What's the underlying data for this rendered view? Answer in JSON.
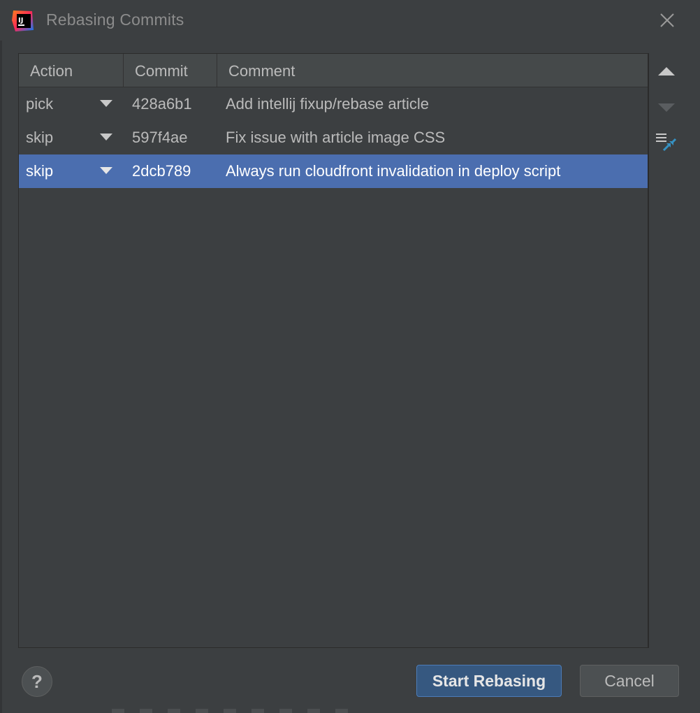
{
  "window": {
    "title": "Rebasing Commits"
  },
  "icons": {
    "app_logo": "intellij-logo-icon",
    "close": "close-icon",
    "move_up": "triangle-up-icon",
    "move_down": "triangle-down-icon",
    "squash": "squash-commits-icon",
    "help": "help-icon"
  },
  "table": {
    "columns": [
      "Action",
      "Commit",
      "Comment"
    ],
    "rows": [
      {
        "action": "pick",
        "commit": "428a6b1",
        "comment": "Add intellij fixup/rebase article",
        "selected": false
      },
      {
        "action": "skip",
        "commit": "597f4ae",
        "comment": "Fix issue with article image CSS",
        "selected": false
      },
      {
        "action": "skip",
        "commit": "2dcb789",
        "comment": "Always run cloudfront invalidation in deploy script",
        "selected": true
      }
    ]
  },
  "buttons": {
    "help_label": "?",
    "start_label": "Start Rebasing",
    "cancel_label": "Cancel"
  },
  "colors": {
    "background": "#3c3f41",
    "selection": "#4b6eaf",
    "primary_button": "#365880",
    "squash_accent": "#3592c4"
  }
}
